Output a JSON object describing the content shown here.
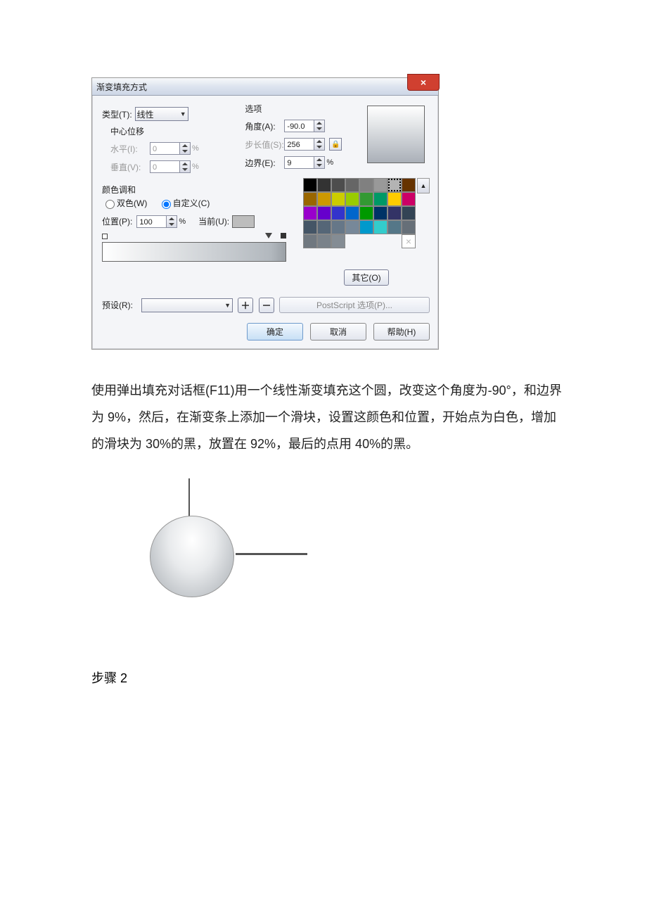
{
  "dialog": {
    "title": "渐变填充方式",
    "type_label": "类型(T):",
    "type_value": "线性",
    "center_offset": "中心位移",
    "horiz_label": "水平(I):",
    "horiz_value": "0",
    "vert_label": "垂直(V):",
    "vert_value": "0",
    "options_label": "选项",
    "angle_label": "角度(A):",
    "angle_value": "-90.0",
    "step_label": "步长值(S):",
    "step_value": "256",
    "edge_label": "边界(E):",
    "edge_value": "9",
    "percent": "%",
    "mix_label": "颜色调和",
    "twocolor_label": "双色(W)",
    "custom_label": "自定义(C)",
    "position_label": "位置(P):",
    "position_value": "100",
    "current_label": "当前(U):",
    "other_label": "其它(O)",
    "preset_label": "预设(R):",
    "plus": "＋",
    "minus": "－",
    "ps_options": "PostScript 选项(P)...",
    "ok": "确定",
    "cancel": "取消",
    "help": "帮助(H)",
    "close_x": "×"
  },
  "palette": [
    [
      "#000000",
      "#333333",
      "#4d4d4d",
      "#666666",
      "#808080",
      "#999999",
      "#b3b3b3"
    ],
    [
      "#663300",
      "#996600",
      "#cc9900",
      "#cccc00",
      "#99cc00",
      "#339933",
      "#009966"
    ],
    [
      "#ffcc00",
      "#cc0066",
      "#9900cc",
      "#6600cc",
      "#3333cc",
      "#0066cc",
      "#009900"
    ],
    [
      "#003366",
      "#333366",
      "#334455",
      "#445566",
      "#556677",
      "#667788",
      "#778899"
    ],
    [
      "#0099cc",
      "#33cccc",
      "#557788",
      "#666f78",
      "#707880",
      "#7a828a",
      "#848c94"
    ]
  ],
  "paragraph": "使用弹出填充对话框(F11)用一个线性渐变填充这个圆，改变这个角度为-90°，和边界为 9%，然后，在渐变条上添加一个滑块，设置这颜色和位置，开始点为白色，增加的滑块为 30%的黑，放置在 92%，最后的点用 40%的黑。",
  "step2": "步骤 2"
}
